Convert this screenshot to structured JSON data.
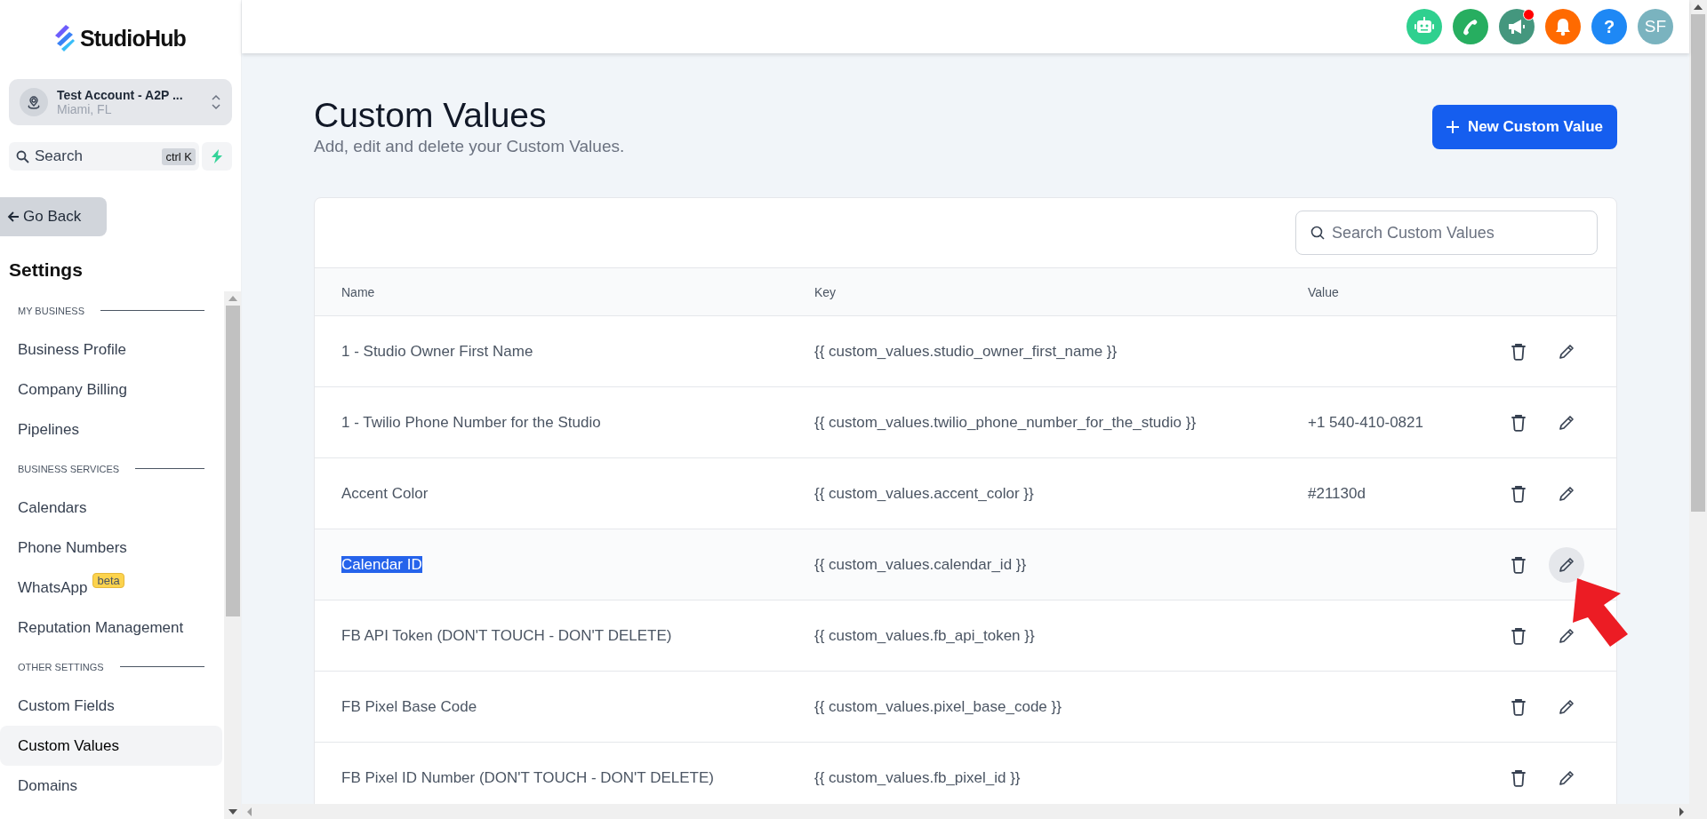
{
  "logo": {
    "text": "StudioHub"
  },
  "account": {
    "name": "Test Account - A2P ...",
    "location": "Miami, FL"
  },
  "search": {
    "placeholder": "Search",
    "shortcut": "ctrl K"
  },
  "back_button": "Go Back",
  "sidebar": {
    "title": "Settings",
    "sections": [
      {
        "heading": "MY BUSINESS",
        "items": [
          {
            "label": "Business Profile",
            "selected": false
          },
          {
            "label": "Company Billing",
            "selected": false
          },
          {
            "label": "Pipelines",
            "selected": false
          }
        ]
      },
      {
        "heading": "BUSINESS SERVICES",
        "items": [
          {
            "label": "Calendars",
            "selected": false
          },
          {
            "label": "Phone Numbers",
            "selected": false
          },
          {
            "label": "WhatsApp",
            "badge": "beta",
            "selected": false
          },
          {
            "label": "Reputation Management",
            "selected": false
          }
        ]
      },
      {
        "heading": "OTHER SETTINGS",
        "items": [
          {
            "label": "Custom Fields",
            "selected": false
          },
          {
            "label": "Custom Values",
            "selected": true
          },
          {
            "label": "Domains",
            "selected": false
          }
        ]
      }
    ]
  },
  "topbar": {
    "icons": [
      {
        "kind": "robot",
        "color": "#2fd08f",
        "notification": false
      },
      {
        "kind": "phone",
        "color": "#27ae60",
        "notification": false
      },
      {
        "kind": "megaphone",
        "color": "#44977e",
        "notification": true
      },
      {
        "kind": "bell",
        "color": "#ff6a00",
        "notification": false
      },
      {
        "kind": "help",
        "text": "?",
        "color": "#1e88f5",
        "notification": false
      },
      {
        "kind": "avatar",
        "text": "SF",
        "color": "#7ab3bf",
        "notification": false
      }
    ]
  },
  "page": {
    "title": "Custom Values",
    "subtitle": "Add, edit and delete your Custom Values.",
    "new_button": "New Custom Value"
  },
  "table": {
    "search_placeholder": "Search Custom Values",
    "columns": [
      "Name",
      "Key",
      "Value"
    ],
    "rows": [
      {
        "name": "1 - Studio Owner First Name",
        "key": "{{ custom_values.studio_owner_first_name }}",
        "hovered": false,
        "name_selected": false
      },
      {
        "name": "1 - Twilio Phone Number for the Studio",
        "key": "{{ custom_values.twilio_phone_number_for_the_studio }}",
        "value": "+1 540-410-0821",
        "hovered": false,
        "name_selected": false
      },
      {
        "name": "Accent Color",
        "key": "{{ custom_values.accent_color }}",
        "value": "#21130d",
        "hovered": false,
        "name_selected": false
      },
      {
        "name": "Calendar ID",
        "key": "{{ custom_values.calendar_id }}",
        "hovered": true,
        "name_selected": true
      },
      {
        "name": "FB API Token (DON'T TOUCH - DON'T DELETE)",
        "key": "{{ custom_values.fb_api_token }}",
        "hovered": false,
        "name_selected": false
      },
      {
        "name": "FB Pixel Base Code",
        "key": "{{ custom_values.pixel_base_code }}",
        "hovered": false,
        "name_selected": false
      },
      {
        "name": "FB Pixel ID Number (DON'T TOUCH - DON'T DELETE)",
        "key": "{{ custom_values.fb_pixel_id }}",
        "hovered": false,
        "name_selected": false
      }
    ]
  }
}
